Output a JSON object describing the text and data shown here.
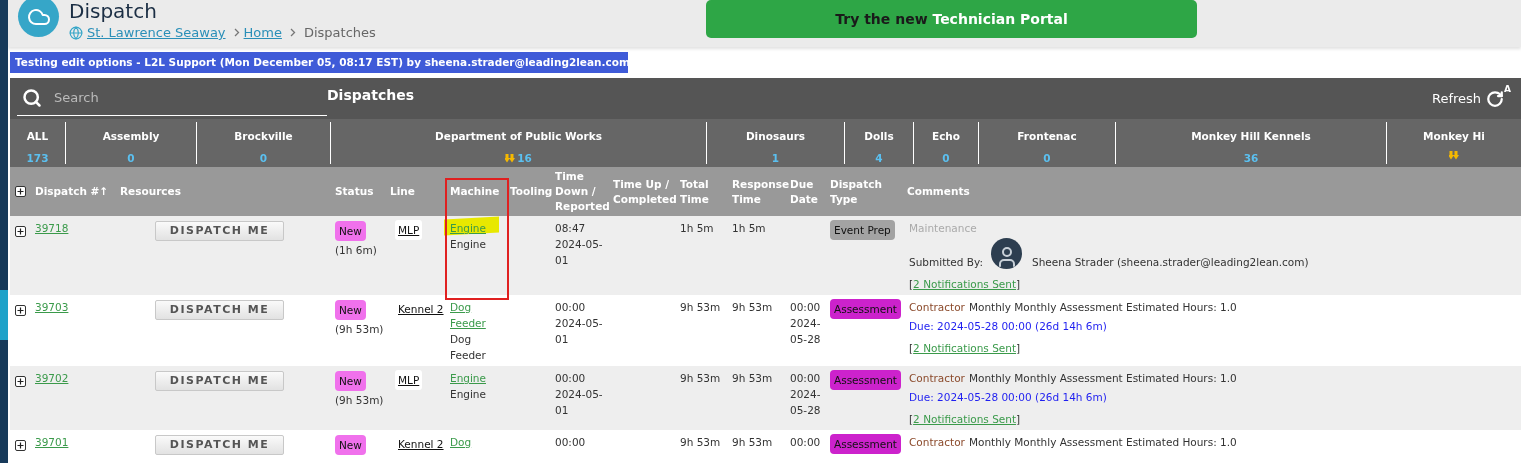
{
  "header": {
    "title": "Dispatch",
    "breadcrumb": [
      {
        "label": "St. Lawrence Seaway",
        "kind": "site"
      },
      {
        "label": "Home",
        "kind": "link"
      },
      {
        "label": "Dispatches",
        "kind": "current"
      }
    ],
    "portal_button": {
      "text": "Try the new",
      "emphasis": "Technician Portal"
    }
  },
  "banner": "Testing edit options - L2L Support (Mon December 05, 08:17 EST) by sheena.strader@leading2lean.com",
  "toolbar": {
    "search": {
      "placeholder": "Search"
    },
    "title": "Dispatches",
    "refresh": {
      "label": "Refresh",
      "badge": "A"
    }
  },
  "departments": [
    {
      "name": "ALL",
      "count": "173",
      "alert": false
    },
    {
      "name": "Assembly",
      "count": "0",
      "alert": false
    },
    {
      "name": "Brockville",
      "count": "0",
      "alert": false
    },
    {
      "name": "Department of Public Works",
      "count": "16",
      "alert": true
    },
    {
      "name": "Dinosaurs",
      "count": "1",
      "alert": false
    },
    {
      "name": "Dolls",
      "count": "4",
      "alert": false
    },
    {
      "name": "Echo",
      "count": "0",
      "alert": false
    },
    {
      "name": "Frontenac",
      "count": "0",
      "alert": false
    },
    {
      "name": "Monkey Hill Kennels",
      "count": "36",
      "alert": false
    },
    {
      "name": "Monkey Hi",
      "alert": true
    }
  ],
  "table": {
    "columns": [
      "Dispatch #↑",
      "Resources",
      "Status",
      "Line",
      "Machine",
      "Tooling",
      "Time Down / Reported",
      "Time Up / Completed",
      "Total Time",
      "Response Time",
      "Due Date",
      "Dispatch Type",
      "Comments"
    ],
    "rows": [
      {
        "id": "39718",
        "button": "DISPATCH ME",
        "status": "New",
        "status_age": "(1h 6m)",
        "line": "MLP",
        "machine_link": "Engine",
        "machine": "Engine",
        "highlighted": true,
        "time_down": "08:47 2024-05-01",
        "total": "1h 5m",
        "response": "1h 5m",
        "type": {
          "label": "Event Prep",
          "color": "#a3a3a3"
        },
        "comments": [
          {
            "kind": "category",
            "category": "Maintenance",
            "color": "#aaaaaa"
          },
          {
            "kind": "submitted",
            "label": "Submitted By:",
            "name": "Sheena Strader (sheena.strader@leading2lean.com)"
          },
          {
            "kind": "notifications",
            "open": "[",
            "link": "2 Notifications Sent",
            "close": "]"
          }
        ]
      },
      {
        "id": "39703",
        "button": "DISPATCH ME",
        "status": "New",
        "status_age": "(9h 53m)",
        "line": "Kennel 2",
        "machine_link": "Dog Feeder",
        "machine": "Dog Feeder",
        "highlighted": false,
        "time_down": "00:00 2024-05-01",
        "total": "9h 53m",
        "response": "9h 53m",
        "due": "00:00 2024-05-28",
        "type": {
          "label": "Assessment",
          "color": "#cc22cc"
        },
        "comments": [
          {
            "kind": "category",
            "category": "Contractor",
            "color": "#8b4a2b",
            "text": "Monthly Monthly Assessment Estimated Hours: 1.0"
          },
          {
            "kind": "due",
            "text": "Due: 2024-05-28 00:00 (26d 14h 6m)"
          },
          {
            "kind": "notifications",
            "open": "[",
            "link": "2 Notifications Sent",
            "close": "]"
          }
        ]
      },
      {
        "id": "39702",
        "button": "DISPATCH ME",
        "status": "New",
        "status_age": "(9h 53m)",
        "line": "MLP",
        "machine_link": "Engine",
        "machine": "Engine",
        "highlighted": false,
        "time_down": "00:00 2024-05-01",
        "total": "9h 53m",
        "response": "9h 53m",
        "due": "00:00 2024-05-28",
        "type": {
          "label": "Assessment",
          "color": "#cc22cc"
        },
        "comments": [
          {
            "kind": "category",
            "category": "Contractor",
            "color": "#8b4a2b",
            "text": "Monthly Monthly Assessment Estimated Hours: 1.0"
          },
          {
            "kind": "due",
            "text": "Due: 2024-05-28 00:00 (26d 14h 6m)"
          },
          {
            "kind": "notifications",
            "open": "[",
            "link": "2 Notifications Sent",
            "close": "]"
          }
        ]
      },
      {
        "id": "39701",
        "button": "DISPATCH ME",
        "status": "New",
        "line": "Kennel 2",
        "machine_link": "Dog",
        "highlighted": false,
        "time_down": "00:00",
        "total": "9h 53m",
        "response": "9h 53m",
        "due": "00:00",
        "type": {
          "label": "Assessment",
          "color": "#cc22cc"
        },
        "comments": [
          {
            "kind": "category",
            "category": "Contractor",
            "color": "#8b4a2b",
            "text": "Monthly Monthly Assessment Estimated Hours: 1.0"
          }
        ]
      }
    ]
  }
}
